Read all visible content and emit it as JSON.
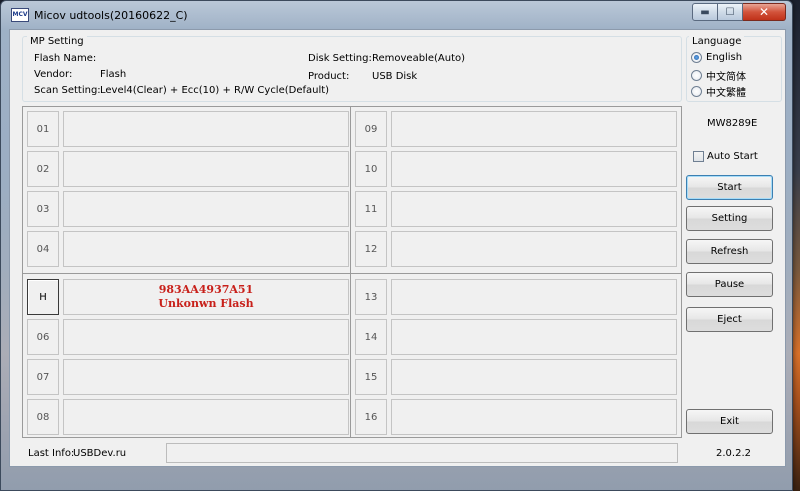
{
  "window": {
    "title": "Micov udtools(20160622_C)",
    "icon_text": "MCV",
    "caption": {
      "minimize_icon": "minimize-icon",
      "maximize_icon": "maximize-icon",
      "close_icon": "close-icon",
      "minimize_glyph": "▬",
      "maximize_glyph": "☐",
      "close_glyph": "✕"
    }
  },
  "mp_setting": {
    "title": "MP Setting",
    "flash_name_label": "Flash Name:",
    "flash_name_value": "",
    "vendor_label": "Vendor:",
    "vendor_value": "Flash",
    "scan_setting_label": "Scan Setting:",
    "scan_setting_value": "Level4(Clear) + Ecc(10) + R/W Cycle(Default)",
    "disk_setting_label": "Disk Setting:",
    "disk_setting_value": "Removeable(Auto)",
    "product_label": "Product:",
    "product_value": "USB Disk"
  },
  "language": {
    "title": "Language",
    "options": [
      {
        "label": "English",
        "checked": true
      },
      {
        "label": "中文简体",
        "checked": false
      },
      {
        "label": "中文繁體",
        "checked": false
      }
    ]
  },
  "ports_left": [
    {
      "num": "01",
      "line1": "",
      "line2": ""
    },
    {
      "num": "02",
      "line1": "",
      "line2": ""
    },
    {
      "num": "03",
      "line1": "",
      "line2": ""
    },
    {
      "num": "04",
      "line1": "",
      "line2": ""
    },
    {
      "num": "H",
      "line1": "983AA4937A51",
      "line2": "Unkonwn Flash"
    },
    {
      "num": "06",
      "line1": "",
      "line2": ""
    },
    {
      "num": "07",
      "line1": "",
      "line2": ""
    },
    {
      "num": "08",
      "line1": "",
      "line2": ""
    }
  ],
  "ports_right": [
    {
      "num": "09"
    },
    {
      "num": "10"
    },
    {
      "num": "11"
    },
    {
      "num": "12"
    },
    {
      "num": "13"
    },
    {
      "num": "14"
    },
    {
      "num": "15"
    },
    {
      "num": "16"
    }
  ],
  "controller": "MW8289E",
  "auto_start_label": "Auto Start",
  "auto_start_checked": false,
  "buttons": {
    "start": "Start",
    "setting": "Setting",
    "refresh": "Refresh",
    "pause": "Pause",
    "eject": "Eject",
    "exit": "Exit"
  },
  "status": {
    "last_info_label": "Last Info:",
    "last_info_value": "USBDev.ru",
    "version": "2.0.2.2"
  },
  "colors": {
    "status_text": "#c8201a",
    "window_frame": "#a9bdd4",
    "client_bg": "#f0f0f0"
  }
}
